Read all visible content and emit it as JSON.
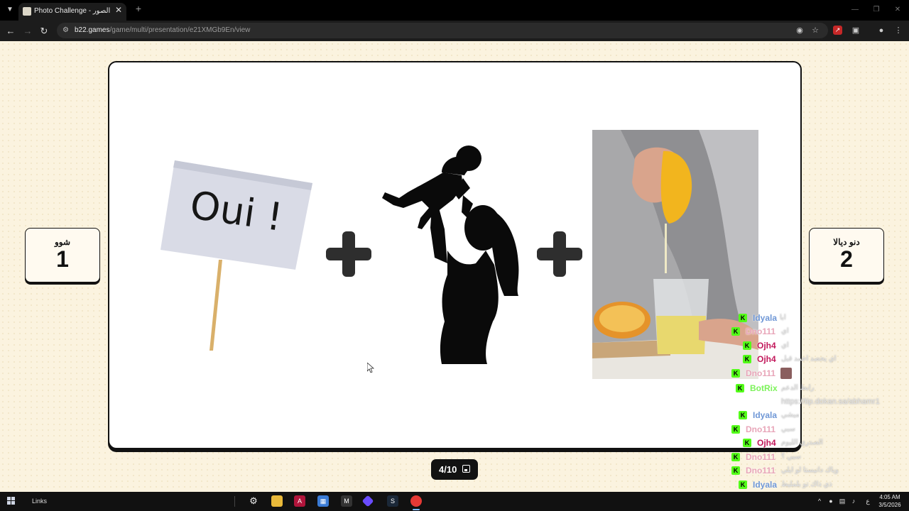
{
  "browser": {
    "tab_title": "Photo Challenge - تحدي الصور",
    "url_host": "b22.games",
    "url_path": "/game/multi/presentation/e21XMGb9En/view"
  },
  "scores": {
    "left": {
      "name": "شوو",
      "value": "1"
    },
    "right": {
      "name": "دنو ديالا",
      "value": "2"
    }
  },
  "slide": {
    "sign_text": "Oui !",
    "progress_label": "4/10"
  },
  "chat": [
    {
      "user": "Idyala",
      "color": "#6f97d6",
      "message": "ابا"
    },
    {
      "user": "Dno111",
      "color": "#e8a6b9",
      "message": "اي"
    },
    {
      "user": "Ojh4",
      "color": "#c2185b",
      "message": "اي"
    },
    {
      "user": "Ojh4",
      "color": "#c2185b",
      "message": "اي يحصد احمد قبل"
    },
    {
      "user": "Dno111",
      "color": "#e8a6b9",
      "message": ""
    },
    {
      "user": "BotRix",
      "color": "#7cf25a",
      "message": "رابط الدعم"
    },
    {
      "user": "",
      "color": "#e8a6b9",
      "message": "https://tip.dokan.sa/abhamr1"
    },
    {
      "user": "Idyala",
      "color": "#6f97d6",
      "message": "ميشي"
    },
    {
      "user": "Dno111",
      "color": "#e8a6b9",
      "message": "سبي"
    },
    {
      "user": "Ojh4",
      "color": "#c2185b",
      "message": "الصدري الليوم"
    },
    {
      "user": "Dno111",
      "color": "#e8a6b9",
      "message": "سبي ؟"
    },
    {
      "user": "Dno111",
      "color": "#e8a6b9",
      "message": "وياك دانيستا لو ايلي"
    },
    {
      "user": "Idyala",
      "color": "#6f97d6",
      "message": "ذي ذاك تو بلمليط"
    }
  ],
  "taskbar": {
    "links_label": "Links",
    "lang": "ع",
    "time": "4:05 AM",
    "date": "3/5/2026"
  }
}
